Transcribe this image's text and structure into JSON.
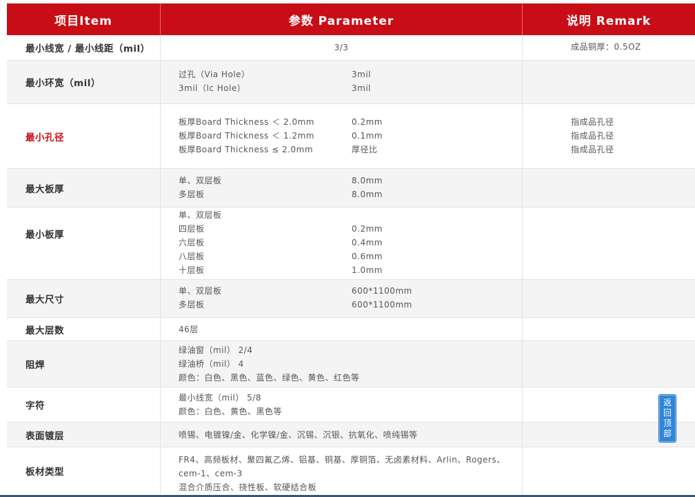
{
  "header": {
    "item": "项目Item",
    "parameter": "参数 Parameter",
    "remark": "说明 Remark"
  },
  "rows": [
    {
      "label": "最小线宽 / 最小线距（mil）",
      "value": "3/3",
      "remark": "成品铜厚：0.5OZ"
    },
    {
      "label": "最小环宽（mil）",
      "lines": [
        {
          "k": "过孔（Via Hole）",
          "v": "3mil"
        },
        {
          "k": "3mil（lc Hole）",
          "v": "3mil"
        }
      ]
    },
    {
      "label": "最小孔径",
      "lines": [
        {
          "k": "板厚Board Thickness ＜ 2.0mm",
          "v": "0.2mm"
        },
        {
          "k": "板厚Board Thickness ＜ 1.2mm",
          "v": "0.1mm"
        },
        {
          "k": "板厚Board Thickness ≤ 2.0mm",
          "v": "厚径比"
        }
      ],
      "remarks": [
        "指成品孔径",
        "指成品孔径",
        "指成品孔径"
      ]
    },
    {
      "label": "最大板厚",
      "lines": [
        {
          "k": "单、双层板",
          "v": "8.0mm"
        },
        {
          "k": "多层板",
          "v": "8.0mm"
        }
      ]
    },
    {
      "label": "最小板厚",
      "lines": [
        {
          "k": "单、双层板",
          "v": ""
        },
        {
          "k": "四层板",
          "v": "0.2mm"
        },
        {
          "k": "六层板",
          "v": "0.4mm"
        },
        {
          "k": "八层板",
          "v": "0.6mm"
        },
        {
          "k": "十层板",
          "v": "1.0mm"
        }
      ]
    },
    {
      "label": "最大尺寸",
      "lines": [
        {
          "k": "单、双层板",
          "v": "600*1100mm"
        },
        {
          "k": "多层板",
          "v": "600*1100mm"
        }
      ]
    },
    {
      "label": "最大层数",
      "text": [
        "46层"
      ]
    },
    {
      "label": "阻焊",
      "text": [
        "绿油窗（mil） 2/4",
        "绿油桥（mil） 4",
        "颜色：白色、黑色、蓝色、绿色、黄色、红色等"
      ]
    },
    {
      "label": "字符",
      "text": [
        "最小线宽（mil） 5/8",
        "颜色：白色、黄色、黑色等"
      ]
    },
    {
      "label": "表面镀层",
      "text": [
        "喷锡、电镀镍/金、化学镍/金、沉锡、沉银、抗氧化、喷纯锡等"
      ]
    },
    {
      "label": "板材类型",
      "text": [
        "FR4、高频板材、聚四氟乙烯、铝基、铜基、厚铜箔、无卤素材料、Arlin、Rogers、",
        "cem-1、cem-3",
        "混合介质压合、挠性板、软硬结合板"
      ]
    }
  ],
  "back_to_top": [
    "返",
    "回",
    "顶",
    "部"
  ]
}
